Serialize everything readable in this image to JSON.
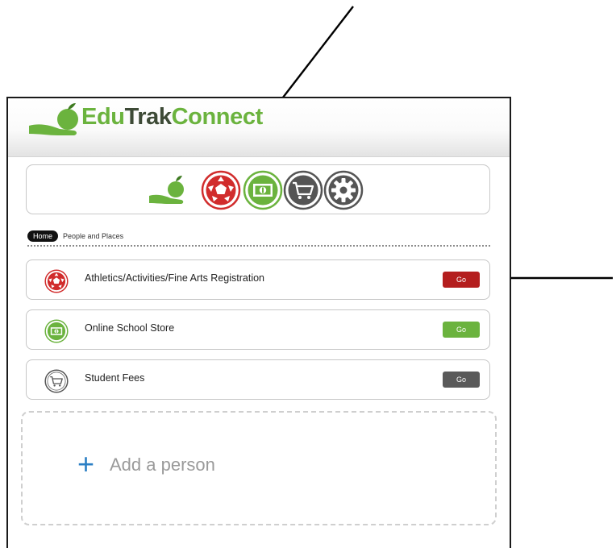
{
  "app": {
    "logo_parts": [
      "Edu",
      "Trak",
      "Connect"
    ],
    "brand_colors": {
      "green": "#6bb33e",
      "dark": "#3d4a36",
      "red": "#b41e1e",
      "gray": "#5a5a5a"
    }
  },
  "icon_bar": {
    "items": [
      {
        "icon": "apple-hand-logo-icon"
      },
      {
        "icon": "soccer-ball-icon"
      },
      {
        "icon": "money-icon"
      },
      {
        "icon": "shopping-cart-icon"
      },
      {
        "icon": "gear-icon"
      }
    ]
  },
  "breadcrumb": {
    "home": "Home",
    "current": "People and Places"
  },
  "list": [
    {
      "icon": "soccer-ball-icon",
      "label": "Athletics/Activities/Fine Arts Registration",
      "button": "Go",
      "button_color": "#b41e1e"
    },
    {
      "icon": "money-icon",
      "label": "Online School Store",
      "button": "Go",
      "button_color": "#6bb33e"
    },
    {
      "icon": "shopping-cart-icon",
      "label": "Student Fees",
      "button": "Go",
      "button_color": "#5a5a5a"
    }
  ],
  "add_person": {
    "plus": "+",
    "label": "Add a person"
  }
}
